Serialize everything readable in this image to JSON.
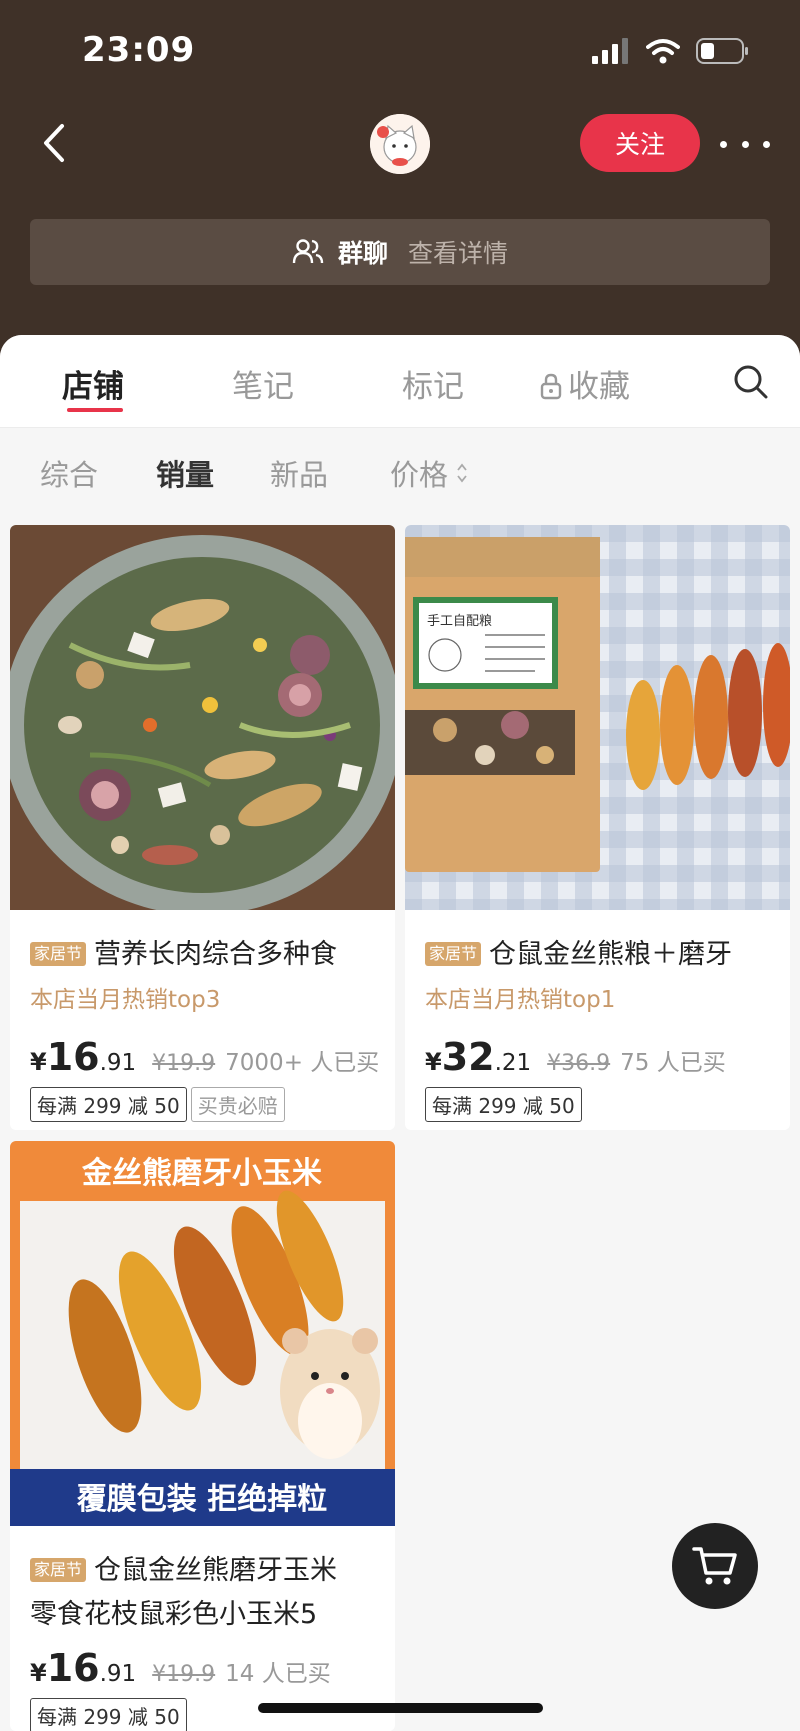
{
  "status": {
    "time": "23:09"
  },
  "header": {
    "follow_label": "关注"
  },
  "group": {
    "title": "群聊",
    "detail": "查看详情"
  },
  "tabs": [
    {
      "label": "店铺",
      "active": true
    },
    {
      "label": "笔记",
      "active": false
    },
    {
      "label": "标记",
      "active": false
    },
    {
      "label": "收藏",
      "active": false,
      "locked": true
    }
  ],
  "sorts": [
    {
      "label": "综合",
      "active": false
    },
    {
      "label": "销量",
      "active": true
    },
    {
      "label": "新品",
      "active": false
    },
    {
      "label": "价格",
      "active": false
    }
  ],
  "products": [
    {
      "tag": "家居节",
      "title": "营养长肉综合多种食",
      "subtitle": "本店当月热销top3",
      "currency": "¥",
      "price_int": "16",
      "price_dec": ".91",
      "old_price": "¥19.9",
      "sold": "7000+ 人已买",
      "coupons": [
        "每满 299 减 50",
        "买贵必赔"
      ]
    },
    {
      "tag": "家居节",
      "title": "仓鼠金丝熊粮＋磨牙",
      "subtitle": "本店当月热销top1",
      "currency": "¥",
      "price_int": "32",
      "price_dec": ".21",
      "old_price": "¥36.9",
      "sold": "75 人已买",
      "coupons": [
        "每满 299 减 50"
      ],
      "image_text": "手工自配粮"
    },
    {
      "tag": "家居节",
      "title_line1": "仓鼠金丝熊磨牙玉米",
      "title_line2": "零食花枝鼠彩色小玉米5",
      "currency": "¥",
      "price_int": "16",
      "price_dec": ".91",
      "old_price": "¥19.9",
      "sold": "14 人已买",
      "coupons": [
        "每满 299 减 50"
      ],
      "banner_top": "金丝熊磨牙小玉米",
      "banner_bottom": "覆膜包装 拒绝掉粒"
    }
  ],
  "colors": {
    "header_bg": "#3f3128",
    "accent": "#e8344a",
    "tag_bg": "#d6a66b"
  },
  "icons": [
    "back-icon",
    "avatar",
    "more-icon",
    "group-icon",
    "lock-icon",
    "search-icon",
    "sort-arrows-icon",
    "cart-icon"
  ]
}
